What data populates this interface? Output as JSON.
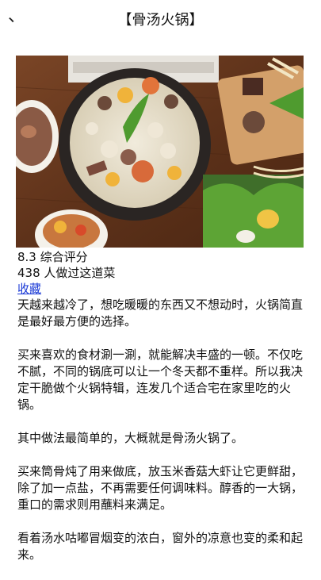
{
  "header": {
    "back_icon": "back-icon",
    "title": "【骨汤火锅】"
  },
  "hero_image": {
    "subject": "bone broth hotpot"
  },
  "stats": {
    "score_line": "8.3 综合评分",
    "made_line": "438 人做过这道菜",
    "favorite_label": "收藏"
  },
  "paragraphs": [
    "天越来越冷了，想吃暖暖的东西又不想动时，火锅简直是最好最方便的选择。",
    "买来喜欢的食材涮一涮，就能解决丰盛的一顿。不仅吃不腻，不同的锅底可以让一个冬天都不重样。所以我决定干脆做个火锅特辑，连发几个适合宅在家里吃的火锅。",
    "其中做法最简单的，大概就是骨汤火锅了。",
    "买来筒骨炖了用来做底，放玉米香菇大虾让它更鲜甜，除了加一点盐，不再需要任何调味料。醇香的一大锅，重口的需求则用蘸料来满足。",
    "看着汤水咕嘟冒烟变的浓白，窗外的凉意也变的柔和起来。"
  ],
  "colors": {
    "link": "#1a39d6",
    "table_wood": "#6b3a1f",
    "broth": "#e9e2cf",
    "pot_rim": "#2a2523"
  }
}
